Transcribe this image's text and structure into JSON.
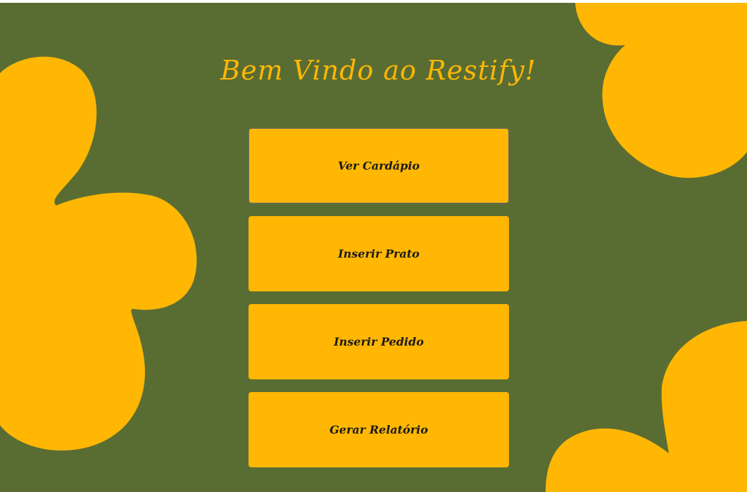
{
  "app": {
    "title": "Bem Vindo ao Restify!"
  },
  "menu": {
    "buttons": [
      {
        "label": "Ver Cardápio",
        "focused": true
      },
      {
        "label": "Inserir Prato",
        "focused": false
      },
      {
        "label": "Inserir Pedido",
        "focused": false
      },
      {
        "label": "Gerar Relatório",
        "focused": false
      }
    ]
  },
  "colors": {
    "background": "#596d33",
    "accent": "#ffb703",
    "button_text": "#1a1a1a"
  }
}
